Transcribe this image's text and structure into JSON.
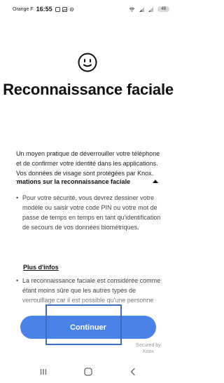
{
  "status_bar": {
    "carrier": "Orange F",
    "time": "16:55",
    "battery": "48"
  },
  "screen": {
    "title": "Reconnaissance faciale",
    "intro": "Un moyen pratique de déverrouiller votre téléphone et de confirmer votre identité dans les applications. Vos données de visage sont protégées par Knox.",
    "section_title": "Informations sur la reconnaissance faciale",
    "bullet_1": "Pour votre sécurité, vous devrez dessiner votre modèle ou saisir votre code PIN ou votre mot de passe de temps en temps en tant qu'identification de secours de vos données biométriques.",
    "more_info_link": "Plus d'infos",
    "bullet_2": "La reconnaissance faciale est considérée comme étant moins sûre que les autres types de verrouillage car il est possible qu'une personne",
    "continue_button": "Continuer",
    "secured_by": "Secured by Knox"
  },
  "icons": {
    "face": "face-icon",
    "caret": "caret-up-icon",
    "nav_recent": "recent-apps-icon",
    "nav_home": "home-icon",
    "nav_back": "back-icon"
  },
  "colors": {
    "accent": "#4a82e8",
    "highlight_box": "#3b6fc0"
  }
}
